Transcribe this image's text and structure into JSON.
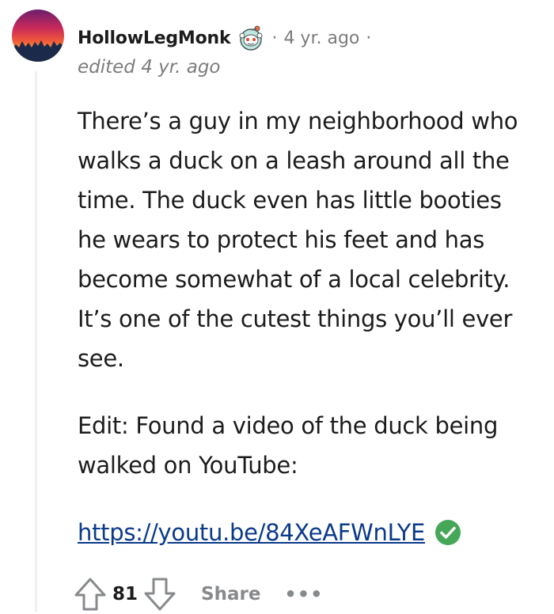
{
  "comment": {
    "username": "HollowLegMonk",
    "separator_before_time": "·",
    "time": "4 yr. ago",
    "separator_after_time": "·",
    "edited": "edited 4 yr. ago",
    "paragraphs": [
      "There’s a guy in my neighborhood who walks a duck on a leash around all the time. The duck even has little booties he wears to protect his feet and has become somewhat of a local celebrity. It’s one of the cutest things you’ll ever see.",
      "Edit: Found a video of the duck being walked on YouTube:"
    ],
    "link": "https://youtu.be/84XeAFWnLYE"
  },
  "actions": {
    "vote_count": "81",
    "share_label": "Share",
    "more_label": "•••"
  },
  "icons": {
    "avatar": "sunset-avatar",
    "flair": "snoo-icon",
    "verified": "check-icon",
    "upvote": "upvote-arrow-icon",
    "downvote": "downvote-arrow-icon",
    "more": "more-options-icon"
  },
  "colors": {
    "text": "#1c1c1c",
    "meta": "#7c7c7c",
    "link": "#0a3a8a",
    "check_green": "#46a758",
    "action_gray": "#878a8c"
  }
}
